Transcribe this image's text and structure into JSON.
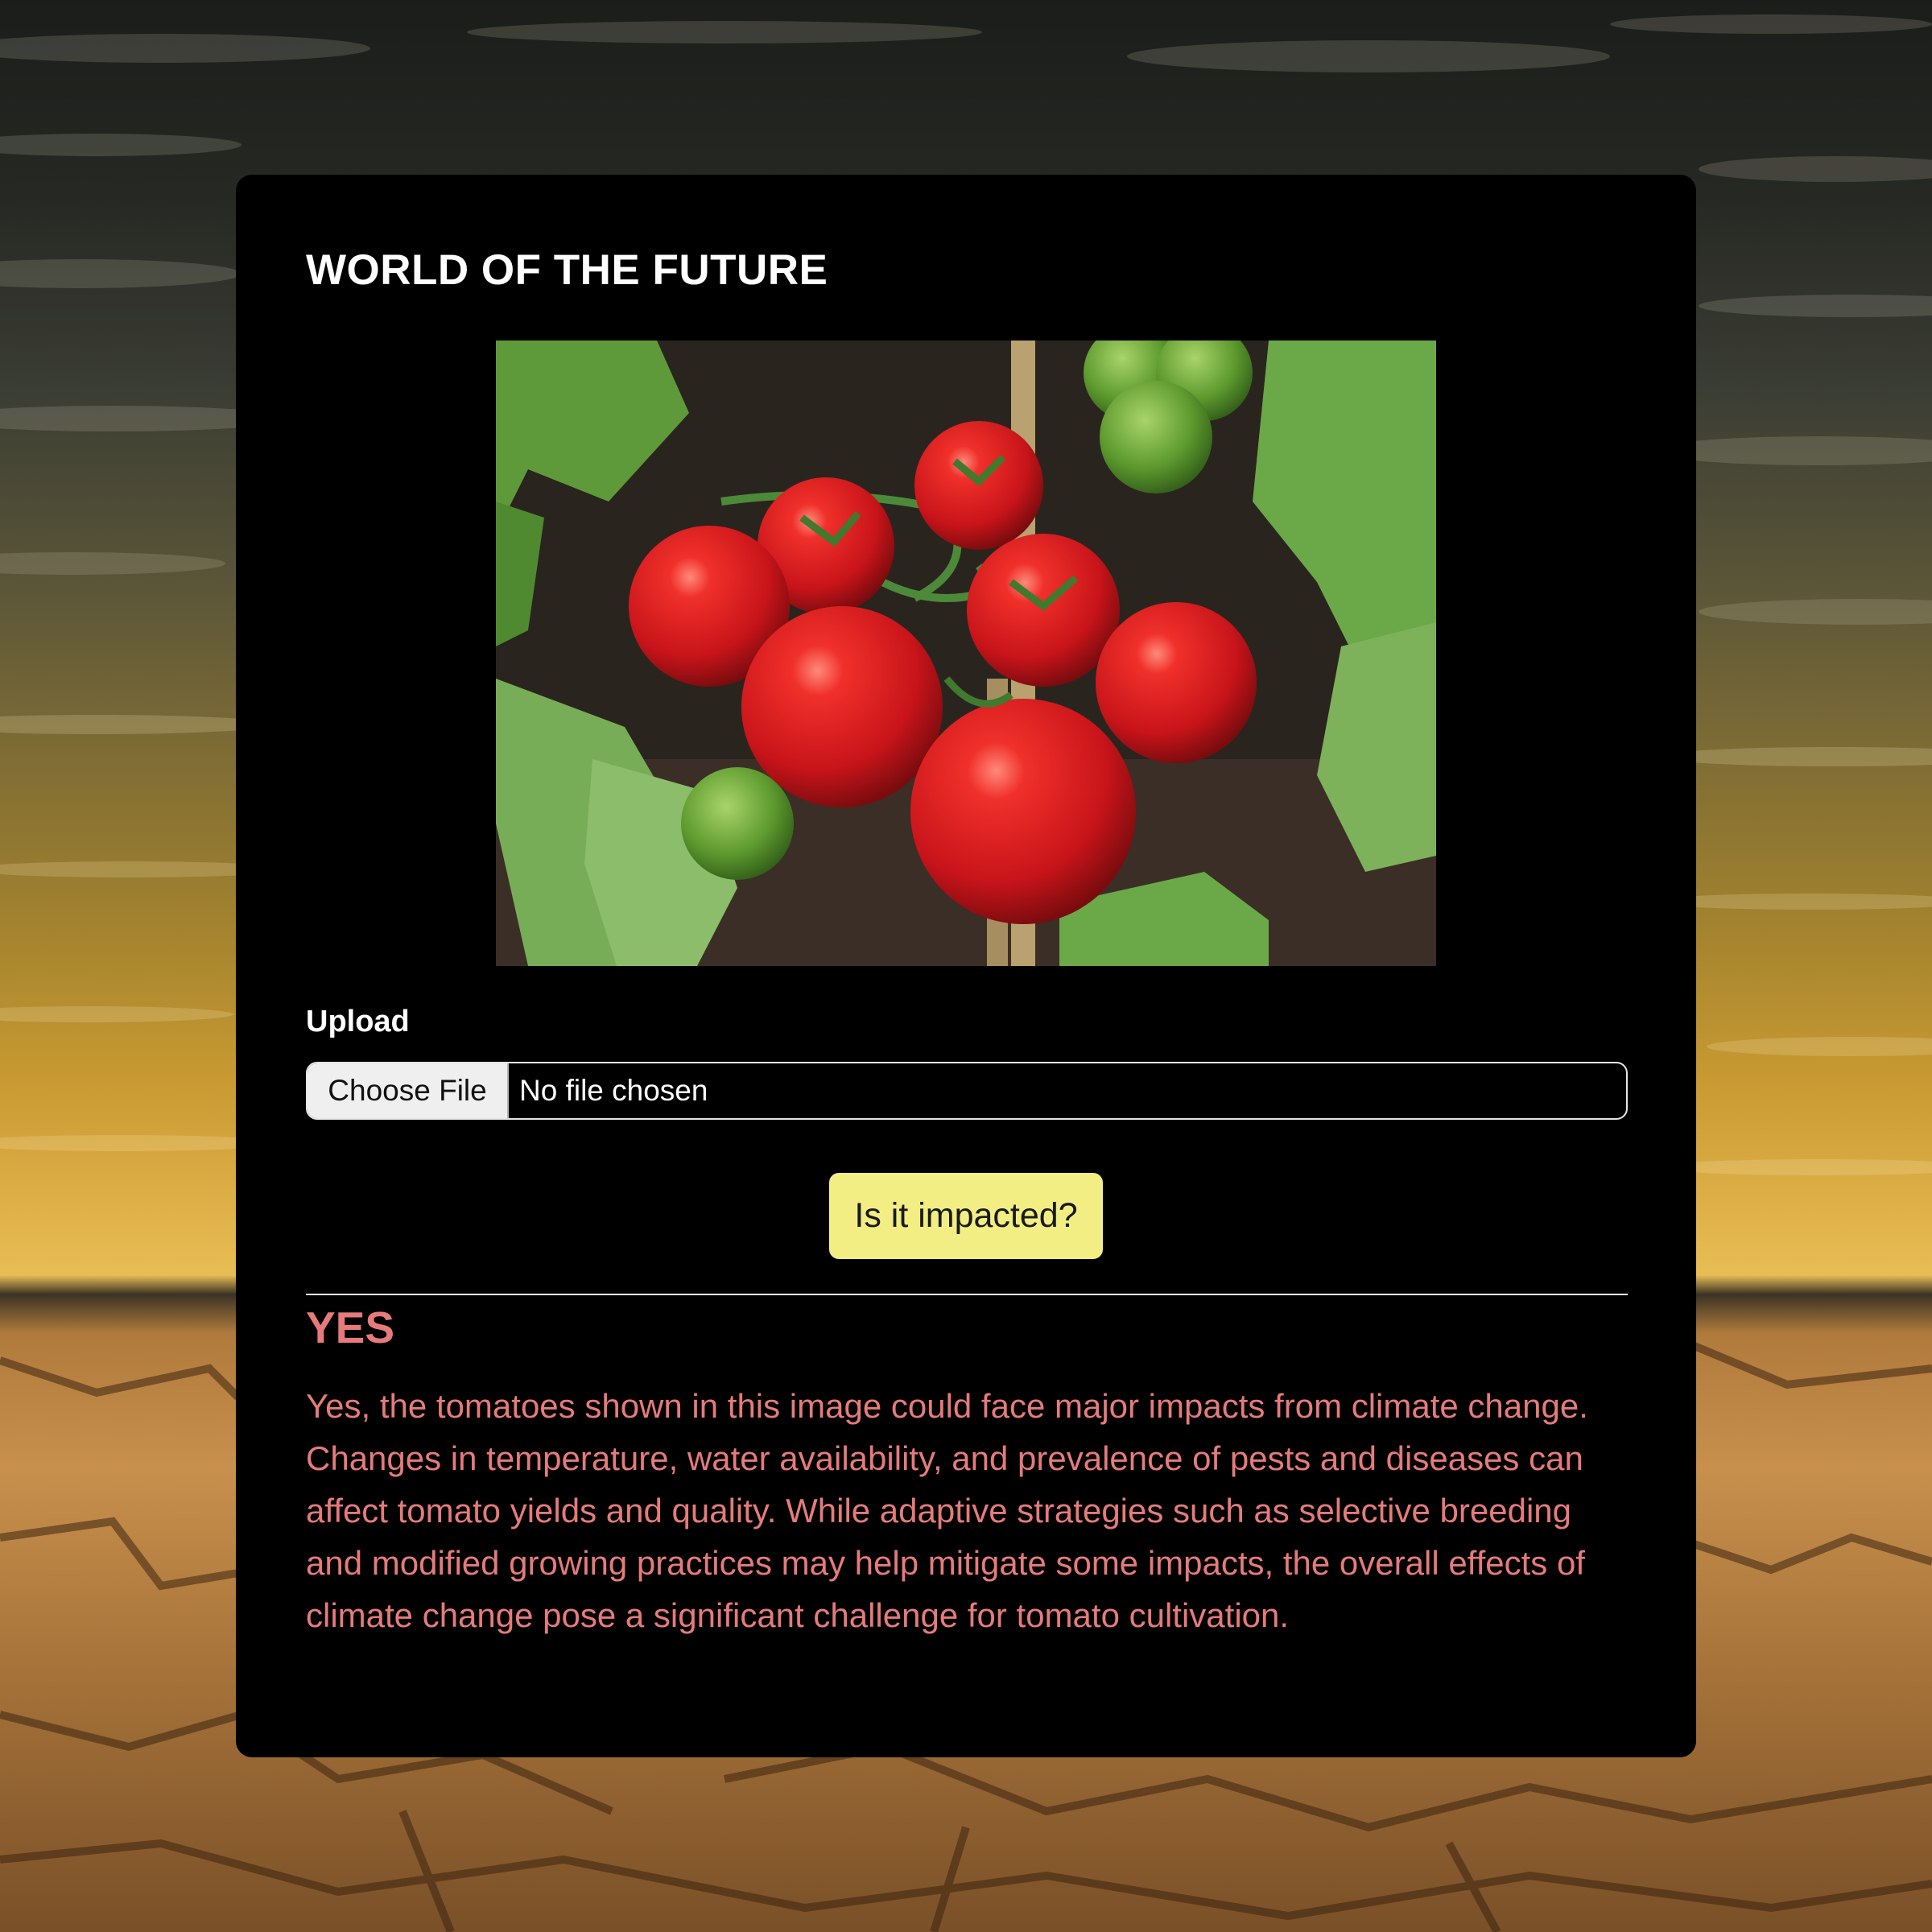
{
  "app": {
    "title": "WORLD OF THE FUTURE"
  },
  "photo": {
    "alt": "Red tomatoes on the vine"
  },
  "upload": {
    "label": "Upload",
    "button_label": "Choose File",
    "status": "No file chosen"
  },
  "actions": {
    "check_label": "Is it impacted?"
  },
  "result": {
    "verdict": "YES",
    "explanation": "Yes, the tomatoes shown in this image could face major impacts from climate change. Changes in temperature, water availability, and prevalence of pests and diseases can affect tomato yields and quality. While adaptive strategies such as selective breeding and modified growing practices may help mitigate some impacts, the overall effects of climate change pose a significant challenge for tomato cultivation."
  },
  "colors": {
    "card_background": "#000000",
    "button_accent": "#f2ee84",
    "result_text": "#e57b7b"
  }
}
